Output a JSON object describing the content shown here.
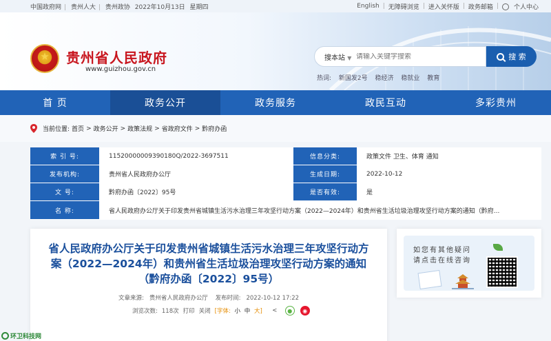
{
  "topbar": {
    "left": [
      "中国政府网",
      "贵州人大",
      "贵州政协",
      "2022年10月13日",
      "星期四"
    ],
    "right": [
      "English",
      "无障碍浏览",
      "进入关怀版",
      "政务邮箱",
      "个人中心"
    ]
  },
  "header": {
    "title": "贵州省人民政府",
    "url": "www.guizhou.gov.cn",
    "search": {
      "scope": "搜本站",
      "placeholder": "请输入关键字搜索",
      "button": "搜 索",
      "hot_label": "热词:",
      "hot_words": [
        "新国发2号",
        "稳经济",
        "稳就业",
        "教育"
      ]
    }
  },
  "nav": [
    "首 页",
    "政务公开",
    "政务服务",
    "政民互动",
    "多彩贵州"
  ],
  "nav_active": 1,
  "breadcrumb": {
    "label": "当前位置:",
    "items": [
      "首页",
      "政务公开",
      "政策法规",
      "省政府文件",
      "黔府办函"
    ],
    "sep": ">"
  },
  "info": {
    "index_label": "索 引 号:",
    "index_value": "11520000009390180Q/2022-3697511",
    "category_label": "信息分类:",
    "category_value": "政策文件    卫生、体育    通知",
    "publisher_label": "发布机构:",
    "publisher_value": "贵州省人民政府办公厅",
    "date_label": "生成日期:",
    "date_value": "2022-10-12",
    "doc_no_label": "文        号:",
    "doc_no_value": "黔府办函〔2022〕95号",
    "valid_label": "是否有效:",
    "valid_value": "是",
    "name_label": "名        称:",
    "name_value": "省人民政府办公厅关于印发贵州省城镇生活污水治理三年攻坚行动方案（2022—2024年）和贵州省生活垃圾治理攻坚行动方案的通知（黔府..."
  },
  "article": {
    "title": "省人民政府办公厅关于印发贵州省城镇生活污水治理三年攻坚行动方案（2022—2024年）和贵州省生活垃圾治理攻坚行动方案的通知（黔府办函〔2022〕95号）",
    "source_label": "文章来源:",
    "source_value": "贵州省人民政府办公厅",
    "time_label": "发布时间:",
    "time_value": "2022-10-12 17:22",
    "views_label": "浏览次数:",
    "views_value": "118次",
    "print": "打印",
    "close": "关闭",
    "font_label": "[字体:",
    "font_small": "小",
    "font_mid": "中",
    "font_large": "大]"
  },
  "side": {
    "question_line1": "如您有其他疑问",
    "question_line2": "请点击在线咨询"
  },
  "watermark": "环卫科技网",
  "colors": {
    "brand_blue": "#2163b7",
    "title_red": "#c8161e",
    "title_blue": "#1a4f9c"
  }
}
